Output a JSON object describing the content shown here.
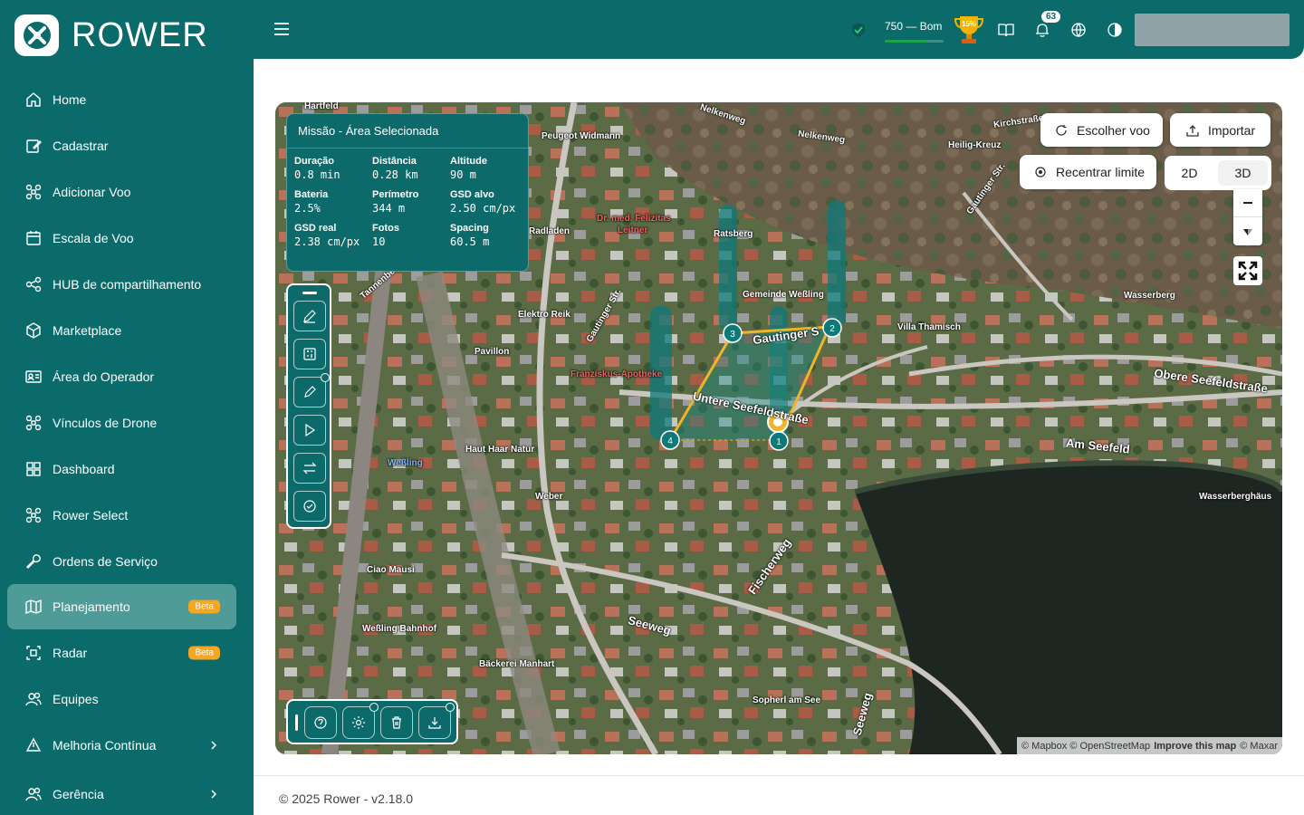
{
  "brand": {
    "name": "ROWER"
  },
  "sidebar": {
    "items": [
      {
        "label": "Home",
        "icon": "home-icon"
      },
      {
        "label": "Cadastrar",
        "icon": "edit-icon"
      },
      {
        "label": "Adicionar Voo",
        "icon": "drone-icon"
      },
      {
        "label": "Escala de Voo",
        "icon": "calendar-icon"
      },
      {
        "label": "HUB de compartilhamento",
        "icon": "share-icon"
      },
      {
        "label": "Marketplace",
        "icon": "box-icon"
      },
      {
        "label": "Área do Operador",
        "icon": "id-card-icon"
      },
      {
        "label": "Vínculos de Drone",
        "icon": "drone-icon"
      },
      {
        "label": "Dashboard",
        "icon": "dashboard-icon"
      },
      {
        "label": "Rower Select",
        "icon": "drone-icon"
      },
      {
        "label": "Ordens de Serviço",
        "icon": "wrench-icon"
      },
      {
        "label": "Planejamento",
        "icon": "map-icon",
        "badge": "Beta",
        "active": true
      },
      {
        "label": "Radar",
        "icon": "radar-icon",
        "badge": "Beta"
      },
      {
        "label": "Equipes",
        "icon": "team-icon"
      },
      {
        "label": "Melhoria Contínua",
        "icon": "improve-icon",
        "expandable": true
      },
      {
        "label": "Gerência",
        "icon": "manage-icon",
        "expandable": true
      }
    ]
  },
  "header": {
    "score_text": "750 — Bom",
    "score_level": 0.7,
    "trophy_label": "15%",
    "notifications_count": "63"
  },
  "map": {
    "info": {
      "title": "Missão - Área Selecionada",
      "stats": [
        {
          "label": "Duração",
          "value": "0.8 min"
        },
        {
          "label": "Distância",
          "value": "0.28 km"
        },
        {
          "label": "Altitude",
          "value": "90 m"
        },
        {
          "label": "Bateria",
          "value": "2.5%"
        },
        {
          "label": "Perímetro",
          "value": "344 m"
        },
        {
          "label": "GSD alvo",
          "value": "2.50 cm/px"
        },
        {
          "label": "GSD real",
          "value": "2.38 cm/px"
        },
        {
          "label": "Fotos",
          "value": "10"
        },
        {
          "label": "Spacing",
          "value": "60.5 m"
        }
      ]
    },
    "controls": {
      "choose_flight": "Escolher voo",
      "import": "Importar",
      "recenter": "Recentrar limite",
      "mode_2d": "2D",
      "mode_3d": "3D"
    },
    "waypoints": [
      "1",
      "2",
      "3",
      "4"
    ],
    "labels": {
      "hartfeld": "Hartfeld",
      "nelkenweg1": "Nelkenweg",
      "nelkenweg2": "Nelkenweg",
      "kirchstr": "Kirchstraße",
      "heilig": "Heilig-Kreuz",
      "peugeot": "Peugeot Widmann",
      "drmed": "Dr. med. Felizitas",
      "leitner": "Leitner",
      "radladen": "Radladen",
      "ratsberg": "Ratsberg",
      "gemeinde": "Gemeinde Weßling",
      "gautinger1": "Gautinger Str.",
      "gautinger2": "Gautinger Str.",
      "gautinger3": "Gautinger S",
      "tannenbe": "Tannenbe",
      "elektro": "Elektro Reik",
      "pavillon": "Pavillon",
      "franz": "Franziskus-Apotheke",
      "untere": "Untere Seefeldstraße",
      "villa": "Villa Thamisch",
      "wasserberg": "Wasserberg",
      "obere": "Obere Seefeldstraße",
      "amseefeld": "Am Seefeld",
      "wasserbergh": "Wasserberghäus",
      "hauthaar": "Haut Haar Natur",
      "wessling": "Weßling",
      "weber": "Weber",
      "fischer": "Fischerweg",
      "ciao": "Ciao Mausi",
      "seeweg1": "Seeweg",
      "seeweg2": "Seeweg",
      "bahnhof": "Weßling Bahnhof",
      "baeckerei": "Bäckerei Manhart",
      "sopherl": "Sopherl am See"
    },
    "attribution": {
      "mapbox": "© Mapbox",
      "osm": "© OpenStreetMap",
      "improve": "Improve this map",
      "maxar": "© Maxar"
    }
  },
  "footer": {
    "text": "© 2025 Rower - v2.18.0"
  },
  "colors": {
    "primary": "#0b6b6b",
    "active_item": "#4f9b98",
    "beta": "#f5a623",
    "route": "#f0b429",
    "corridor": "#0d7a7a"
  }
}
